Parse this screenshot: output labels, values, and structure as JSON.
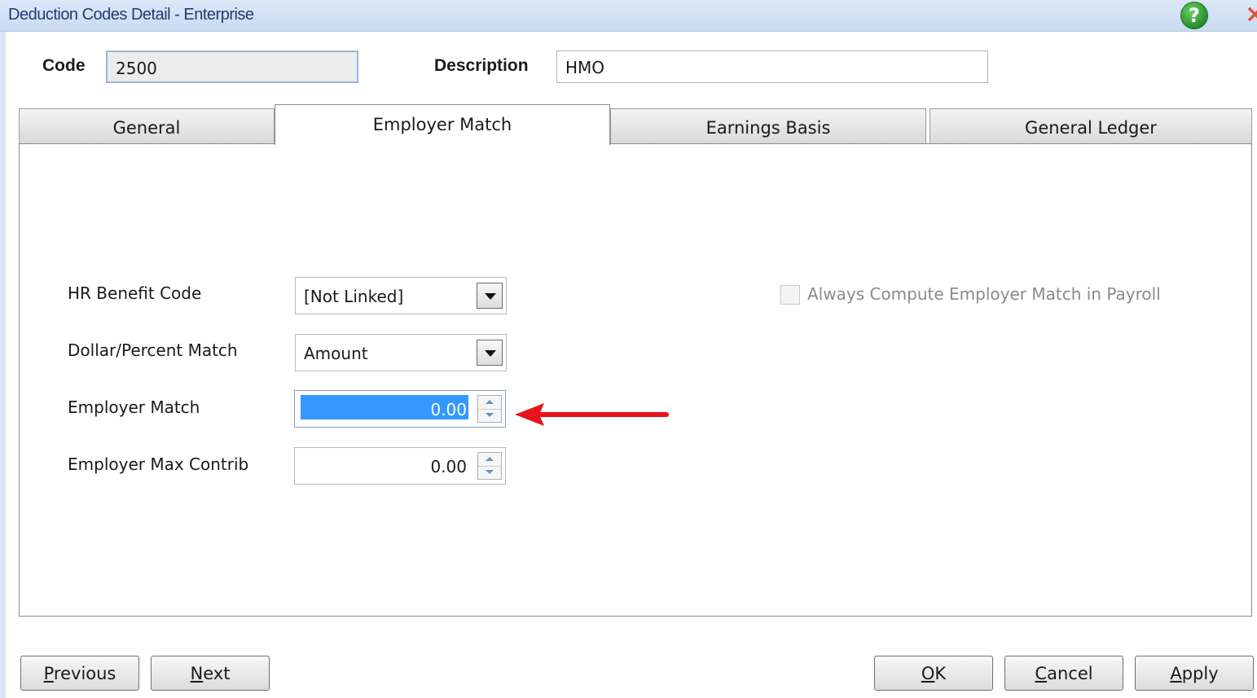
{
  "window": {
    "title": "Deduction Codes Detail - Enterprise",
    "help_icon": "?",
    "close_icon": "×"
  },
  "header": {
    "code_label": "Code",
    "code_value": "2500",
    "description_label": "Description",
    "description_value": "HMO"
  },
  "tabs": [
    {
      "label": "General",
      "active": false
    },
    {
      "label": "Employer Match",
      "active": true
    },
    {
      "label": "Earnings Basis",
      "active": false
    },
    {
      "label": "General Ledger",
      "active": false
    }
  ],
  "form": {
    "hr_benefit_code": {
      "label": "HR Benefit Code",
      "value": "[Not Linked]"
    },
    "dollar_percent_match": {
      "label": "Dollar/Percent Match",
      "value": "Amount"
    },
    "employer_match": {
      "label": "Employer Match",
      "value": "0.00"
    },
    "employer_max_contrib": {
      "label": "Employer Max Contrib",
      "value": "0.00"
    },
    "always_compute": {
      "label": "Always Compute Employer Match in Payroll",
      "checked": false,
      "enabled": false
    }
  },
  "buttons": {
    "previous": {
      "mnemonic": "P",
      "rest": "revious"
    },
    "next": {
      "mnemonic": "N",
      "rest": "ext"
    },
    "ok": {
      "mnemonic": "O",
      "rest": "K"
    },
    "cancel": {
      "mnemonic": "C",
      "rest": "ancel"
    },
    "apply": {
      "mnemonic": "A",
      "rest": "pply"
    }
  },
  "annotation": {
    "type": "arrow",
    "color": "#e8141b"
  }
}
